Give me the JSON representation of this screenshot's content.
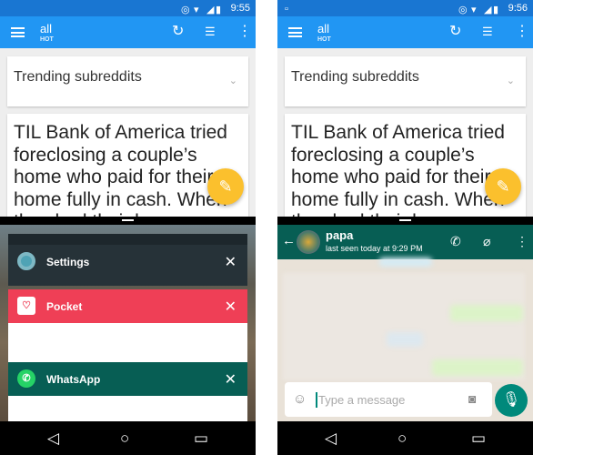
{
  "left_phone": {
    "status": {
      "time": "9:55"
    },
    "toolbar": {
      "title": "all",
      "subtitle": "HOT"
    },
    "trending_label": "Trending subreddits",
    "post_text": "TIL Bank of America tried foreclosing a couple’s home who paid for their home fully in cash. When they had their home foreclosed",
    "recents": [
      {
        "label": "Settings",
        "color": "#263238",
        "icon": "settings-gear-icon"
      },
      {
        "label": "Pocket",
        "color": "#ef3f56",
        "icon": "pocket-icon"
      },
      {
        "label": "WhatsApp",
        "color": "#075e54",
        "icon": "whatsapp-icon"
      }
    ]
  },
  "right_phone": {
    "status": {
      "time": "9:56"
    },
    "toolbar": {
      "title": "all",
      "subtitle": "HOT"
    },
    "trending_label": "Trending subreddits",
    "post_text": "TIL Bank of America tried foreclosing a couple’s home who paid for their home fully in cash. When they had their home foreclosed",
    "chat": {
      "contact_name": "papa",
      "last_seen": "last seen today at 9:29 PM",
      "input_placeholder": "Type a message",
      "header_color": "#075e54",
      "accent": "#00897b"
    }
  },
  "colors": {
    "status_bar": "#1976d2",
    "toolbar": "#2196f3",
    "fab": "#fbc02d"
  }
}
